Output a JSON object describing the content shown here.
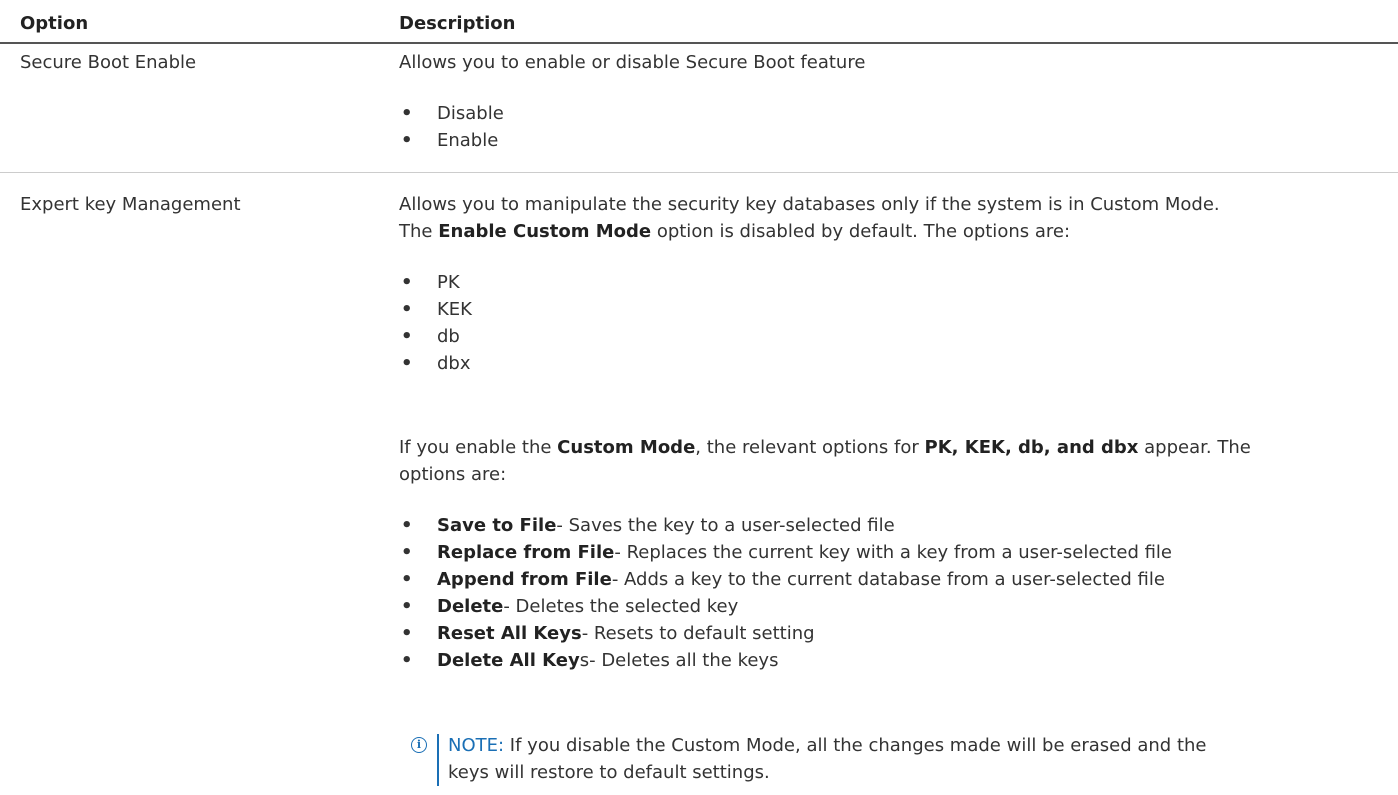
{
  "table": {
    "header": {
      "option": "Option",
      "description": "Description"
    },
    "rows": [
      {
        "option": "Secure Boot Enable",
        "intro": "Allows you to enable or disable Secure Boot feature",
        "bullets": [
          "Disable",
          "Enable"
        ]
      },
      {
        "option": "Expert key Management",
        "intro_line1": "Allows you to manipulate the security key databases only if the system is in Custom Mode.",
        "intro_line2_pre": "The ",
        "intro_line2_bold": "Enable Custom Mode",
        "intro_line2_post": " option is disabled by default. The options are:",
        "keys": [
          "PK",
          "KEK",
          "db",
          "dbx"
        ],
        "custom_pre": "If you enable the ",
        "custom_bold1": "Custom Mode",
        "custom_mid": ", the relevant options for ",
        "custom_bold2": "PK, KEK, db, and dbx",
        "custom_post": " appear. The",
        "custom_line2": "options are:",
        "actions": [
          {
            "bold": "Save to File",
            "rest": "- Saves the key to a user-selected file"
          },
          {
            "bold": "Replace from File",
            "rest": "- Replaces the current key with a key from a user-selected file"
          },
          {
            "bold": "Append from File",
            "rest": "- Adds a key to the current database from a user-selected file"
          },
          {
            "bold": "Delete",
            "rest": "- Deletes the selected key"
          },
          {
            "bold": "Reset All Keys",
            "rest": "- Resets to default setting"
          },
          {
            "bold": "Delete All Key",
            "rest": "s- Deletes all the keys"
          }
        ],
        "note": {
          "label": "NOTE:",
          "text_line1": " If you disable the Custom Mode, all the changes made will be erased and the",
          "text_line2": "keys will restore to default settings."
        }
      }
    ]
  },
  "colors": {
    "text": "#333333",
    "note_accent": "#1a6fb5",
    "header_rule": "#555555"
  },
  "icons": {
    "bullet": "•",
    "note_icon": "info-icon"
  }
}
